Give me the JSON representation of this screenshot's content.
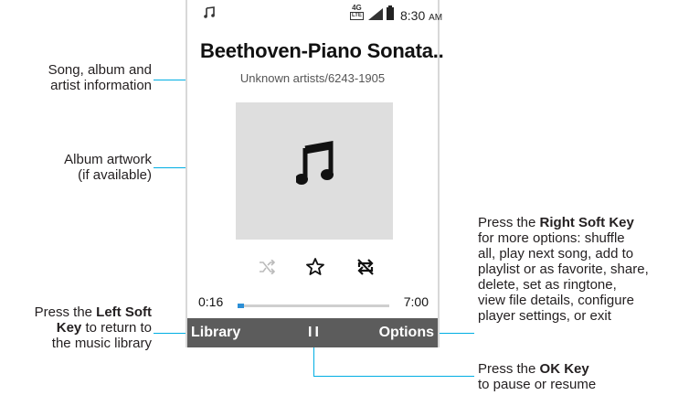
{
  "status_bar": {
    "network": "4G",
    "network_sub": "LTE",
    "time": "8:30",
    "time_suffix": "AM"
  },
  "player": {
    "title": "Beethoven-Piano Sonata..",
    "subtitle": "Unknown artists/6243-1905",
    "current_time": "0:16",
    "total_time": "7:00",
    "progress": 0.04
  },
  "softkeys": {
    "left": "Library",
    "center": "II",
    "right": "Options"
  },
  "callouts": {
    "song_info_1": "Song, album and",
    "song_info_2": "artist information",
    "artwork_1": "Album artwork",
    "artwork_2": "(if available)",
    "left_key_pre": "Press the ",
    "left_key_bold_1": "Left Soft",
    "left_key_bold_2": "Key",
    "left_key_post": " to return to",
    "left_key_3": "the music library",
    "right_key_pre": "Press the ",
    "right_key_bold": "Right Soft Key",
    "right_key_2": "for more options: shuffle",
    "right_key_3": "all, play next song, add to",
    "right_key_4": "playlist or as favorite, share,",
    "right_key_5": "delete, set as ringtone,",
    "right_key_6": "view file details, configure",
    "right_key_7": "player settings, or exit",
    "ok_key_pre": "Press the ",
    "ok_key_bold": "OK Key",
    "ok_key_2": "to pause or resume"
  },
  "colors": {
    "callout_line": "#00aee3",
    "softkey_bar": "#5c5c5c",
    "progress_fill": "#2c8fd6",
    "artwork_bg": "#dedede"
  }
}
